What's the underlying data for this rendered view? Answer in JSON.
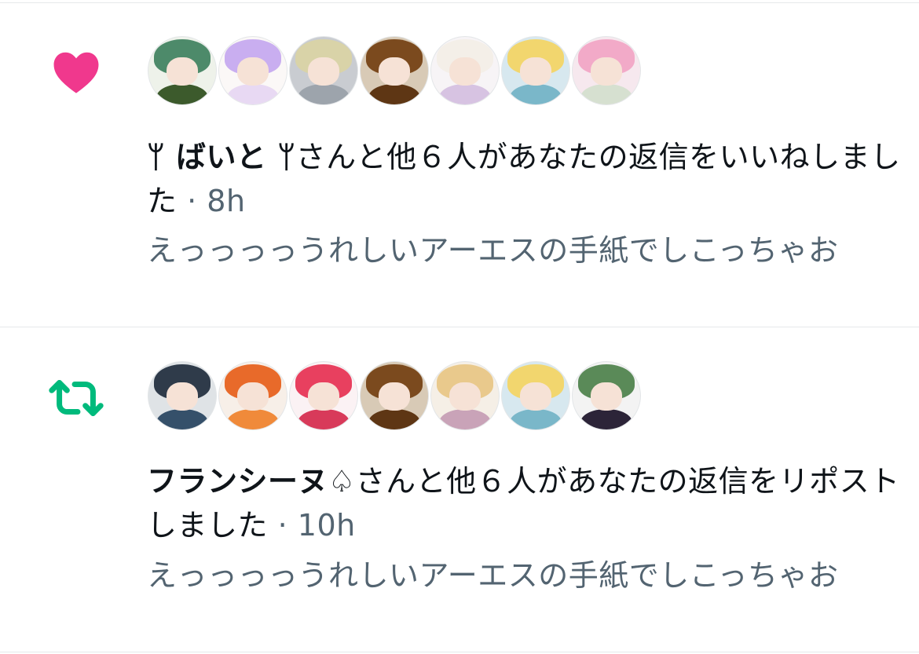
{
  "colors": {
    "like": "#f0388d",
    "repost": "#00ba7c",
    "secondary_text": "#536471",
    "divider": "#e6e9eb"
  },
  "notifications": [
    {
      "type": "like",
      "icon": "heart-icon",
      "actor": "ᛘ ばいと ᛘ",
      "action": "さんと他６人があなたの返信をいいねしました",
      "separator": " · ",
      "time": "8h",
      "snippet": "えっっっっうれしいアーエスの手紙でしこっちゃお",
      "avatars": [
        {
          "name": "avatar-1",
          "bg": "#eef2ea",
          "hair": "#4d8a6a",
          "body": "#3c5a2c"
        },
        {
          "name": "avatar-2",
          "bg": "#fbf8f7",
          "hair": "#c9aef0",
          "body": "#e8d9f3"
        },
        {
          "name": "avatar-3",
          "bg": "#c9ccd1",
          "hair": "#d9d3a8",
          "body": "#9da4ac"
        },
        {
          "name": "avatar-4",
          "bg": "#d8cab6",
          "hair": "#7b4a1e",
          "body": "#5e3614"
        },
        {
          "name": "avatar-5",
          "bg": "#f7f4f6",
          "hair": "#f4efe8",
          "body": "#d7c3e2"
        },
        {
          "name": "avatar-6",
          "bg": "#d7e8ef",
          "hair": "#f2d66e",
          "body": "#7ab7c9"
        },
        {
          "name": "avatar-7",
          "bg": "#f6e8ee",
          "hair": "#f2aac8",
          "body": "#d6e0d0"
        }
      ]
    },
    {
      "type": "repost",
      "icon": "repost-icon",
      "actor": "フランシーヌ♤",
      "action": "さんと他６人があなたの返信をリポストしました",
      "separator": " · ",
      "time": "10h",
      "snippet": "えっっっっうれしいアーエスの手紙でしこっちゃお",
      "avatars": [
        {
          "name": "avatar-1",
          "bg": "#dfe3e6",
          "hair": "#2f3b4a",
          "body": "#35506a"
        },
        {
          "name": "avatar-2",
          "bg": "#f7efe8",
          "hair": "#e86a2a",
          "body": "#f08a3a"
        },
        {
          "name": "avatar-3",
          "bg": "#fbf2f4",
          "hair": "#e8405f",
          "body": "#d83a5a"
        },
        {
          "name": "avatar-4",
          "bg": "#d8cab6",
          "hair": "#7b4a1e",
          "body": "#5e3614"
        },
        {
          "name": "avatar-5",
          "bg": "#f5efe6",
          "hair": "#e9c98c",
          "body": "#c9a3b8"
        },
        {
          "name": "avatar-6",
          "bg": "#d7e8ef",
          "hair": "#f2d66e",
          "body": "#7ab7c9"
        },
        {
          "name": "avatar-7",
          "bg": "#f3f3f3",
          "hair": "#5a8a58",
          "body": "#2c2438"
        }
      ]
    }
  ]
}
